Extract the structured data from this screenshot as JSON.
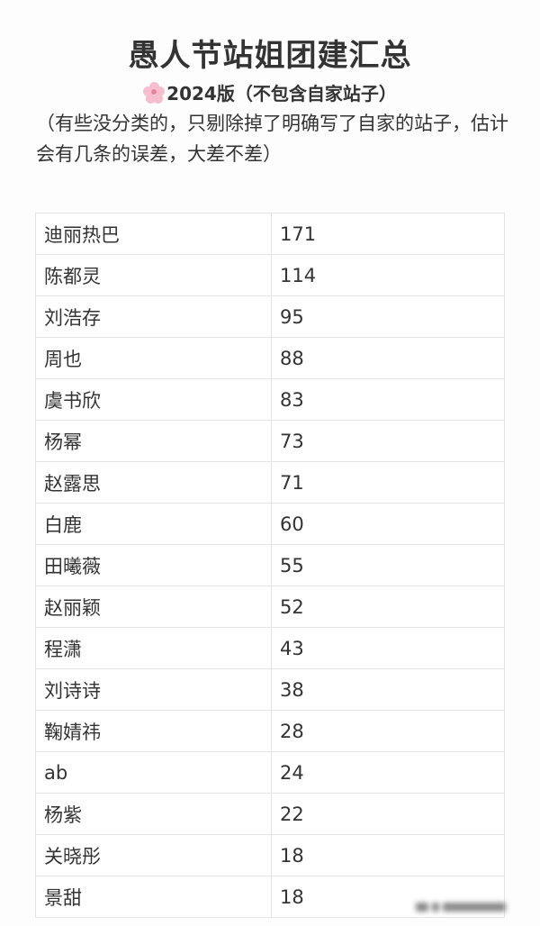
{
  "header": {
    "title": "愚人节站姐团建汇总",
    "subtitle_icon": "cherry-blossom-icon",
    "subtitle": "2024版（不包含自家站子）",
    "note": "（有些没分类的，只剔除掉了明确写了自家的站子，估计会有几条的误差，大差不差）"
  },
  "table": {
    "rows": [
      {
        "name": "迪丽热巴",
        "count": "171"
      },
      {
        "name": "陈都灵",
        "count": "114"
      },
      {
        "name": "刘浩存",
        "count": "95"
      },
      {
        "name": "周也",
        "count": "88"
      },
      {
        "name": "虞书欣",
        "count": "83"
      },
      {
        "name": "杨幂",
        "count": "73"
      },
      {
        "name": "赵露思",
        "count": "71"
      },
      {
        "name": "白鹿",
        "count": "60"
      },
      {
        "name": "田曦薇",
        "count": "55"
      },
      {
        "name": "赵丽颖",
        "count": "52"
      },
      {
        "name": "程潇",
        "count": "43"
      },
      {
        "name": "刘诗诗",
        "count": "38"
      },
      {
        "name": "鞠婧祎",
        "count": "28"
      },
      {
        "name": "ab",
        "count": "24"
      },
      {
        "name": "杨紫",
        "count": "22"
      },
      {
        "name": "关晓彤",
        "count": "18"
      },
      {
        "name": "景甜",
        "count": "18"
      }
    ]
  }
}
